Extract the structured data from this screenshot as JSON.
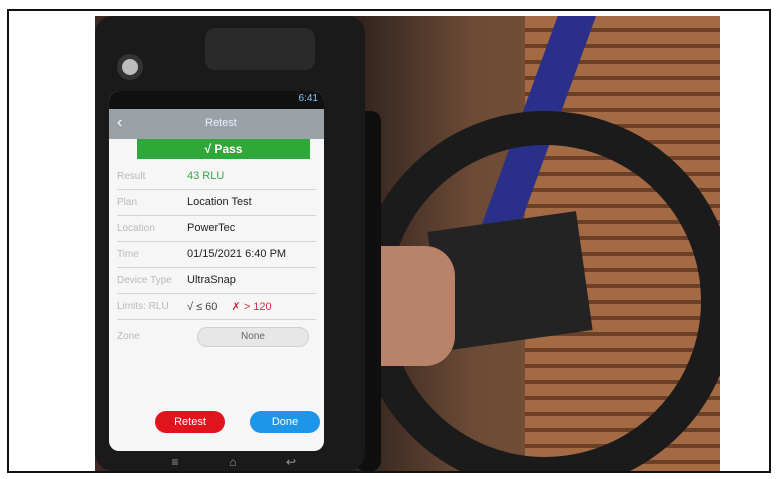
{
  "screen": {
    "status_time": "6:41",
    "title": "Retest",
    "pass_label": "√ Pass",
    "fields": [
      {
        "label": "Result",
        "value": "43 RLU"
      },
      {
        "label": "Plan",
        "value": "Location Test"
      },
      {
        "label": "Location",
        "value": "PowerTec"
      },
      {
        "label": "Time",
        "value": "01/15/2021 6:40 PM"
      },
      {
        "label": "Device Type",
        "value": "UltraSnap"
      }
    ],
    "limits": {
      "label": "Limits: RLU",
      "pass": "√ ≤ 60",
      "fail": "✗ > 120"
    },
    "zone": {
      "label": "Zone",
      "value": "None"
    },
    "buttons": {
      "retest": "Retest",
      "done": "Done"
    }
  },
  "icons": {
    "back": "chevron-left-icon",
    "nav": [
      "menu-icon",
      "home-icon",
      "back-icon"
    ]
  }
}
